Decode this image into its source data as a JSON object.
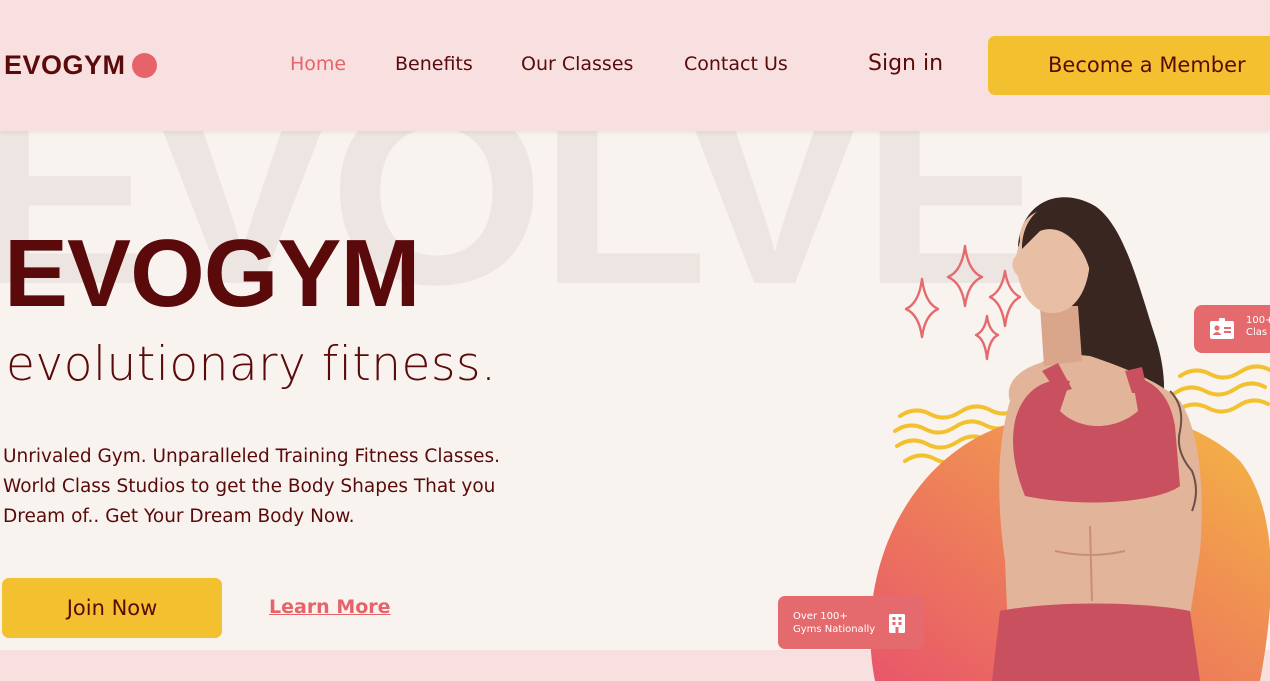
{
  "nav": {
    "logo_text": "EVOGYM",
    "links": [
      {
        "label": "Home",
        "active": true
      },
      {
        "label": "Benefits",
        "active": false
      },
      {
        "label": "Our Classes",
        "active": false
      },
      {
        "label": "Contact Us",
        "active": false
      }
    ],
    "sign_in": "Sign in",
    "member_button": "Become a Member"
  },
  "hero": {
    "watermark": "EVOLVE",
    "title": "EVOGYM",
    "subtitle": "evolutionary fitness.",
    "description": "Unrivaled Gym. Unparalleled Training Fitness Classes. World Class Studios to get the Body Shapes That you Dream of.. Get Your Dream Body Now.",
    "join_button": "Join Now",
    "learn_more": "Learn More"
  },
  "badges": {
    "gyms_line1": "Over 100+",
    "gyms_line2": "Gyms Nationally",
    "gyms_icon": "building-icon",
    "classes_line1": "100+",
    "classes_line2": "Clas",
    "classes_icon": "id-card-icon"
  },
  "colors": {
    "primary_dark": "#5a0a0a",
    "accent_red": "#e7636a",
    "accent_yellow": "#f3c12f",
    "nav_bg": "#f8e0e0",
    "page_bg": "#f8f3ee"
  }
}
